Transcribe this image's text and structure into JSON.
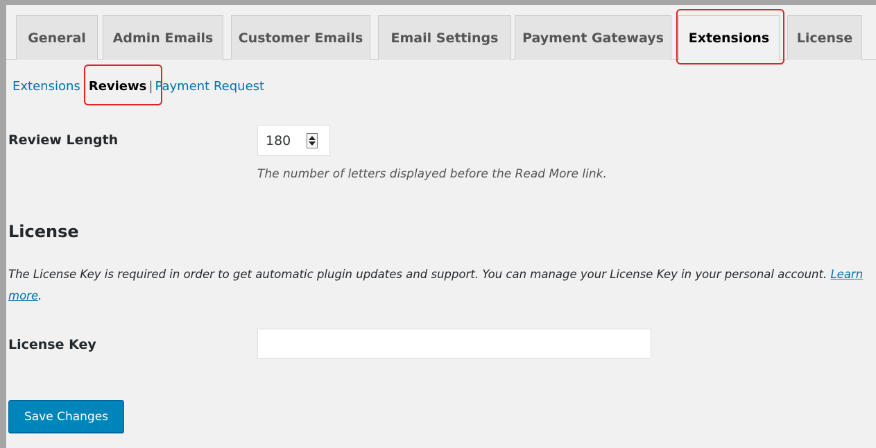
{
  "tabs": [
    {
      "label": "General",
      "active": false
    },
    {
      "label": "Admin Emails",
      "active": false
    },
    {
      "label": "Customer Emails",
      "active": false
    },
    {
      "label": "Email Settings",
      "active": false
    },
    {
      "label": "Payment Gateways",
      "active": false
    },
    {
      "label": "Extensions",
      "active": true
    },
    {
      "label": "License",
      "active": false
    }
  ],
  "subnav": {
    "items": [
      "Extensions",
      "Reviews",
      "Payment Request"
    ],
    "current": "Reviews",
    "separator": "|"
  },
  "review_length": {
    "label": "Review Length",
    "value": "180",
    "description": "The number of letters displayed before the Read More link."
  },
  "license": {
    "heading": "License",
    "description_before": "The License Key is required in order to get automatic plugin updates and support. You can manage your License Key in your personal account. ",
    "learn_more": "Learn more",
    "description_after": ".",
    "key_label": "License Key",
    "key_value": ""
  },
  "save_button": "Save Changes",
  "colors": {
    "link": "#0073aa",
    "primary_button": "#0085ba",
    "highlight": "#e02424",
    "background": "#f1f1f1"
  }
}
